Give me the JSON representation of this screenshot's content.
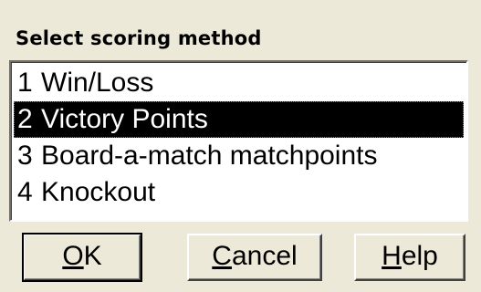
{
  "dialog": {
    "title": "Select scoring method"
  },
  "list": {
    "items": [
      {
        "num": "1",
        "label": "Win/Loss",
        "selected": false
      },
      {
        "num": "2",
        "label": "Victory Points",
        "selected": true
      },
      {
        "num": "3",
        "label": "Board-a-match matchpoints",
        "selected": false
      },
      {
        "num": "4",
        "label": "Knockout",
        "selected": false
      }
    ]
  },
  "buttons": {
    "ok": {
      "accel": "O",
      "rest": "K"
    },
    "cancel": {
      "accel": "C",
      "rest": "ancel"
    },
    "help": {
      "accel": "H",
      "rest": "elp"
    }
  },
  "colors": {
    "face": "#ece9d8",
    "selection": "#000000",
    "selection_text": "#ffffff"
  }
}
